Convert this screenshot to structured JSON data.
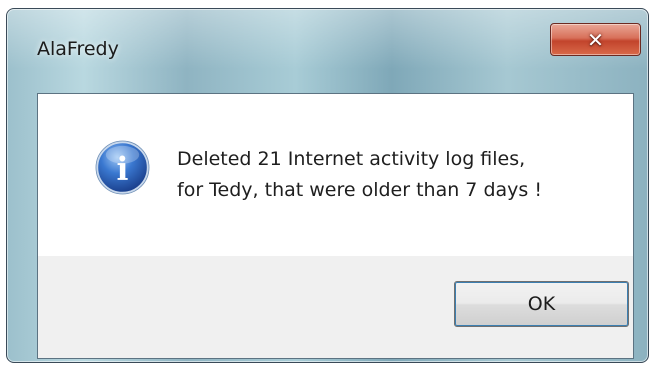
{
  "window": {
    "title": "AlaFredy",
    "close_glyph": "✕"
  },
  "dialog": {
    "icon": "info-icon",
    "icon_glyph": "i",
    "message_lines": [
      "Deleted 21 Internet activity log files,",
      "for Tedy, that were older than 7 days !"
    ],
    "ok_label": "OK"
  },
  "colors": {
    "close_button_red": "#c7452d",
    "info_icon_blue": "#2a5fb8",
    "ok_focus_border": "#3c7fb1"
  }
}
